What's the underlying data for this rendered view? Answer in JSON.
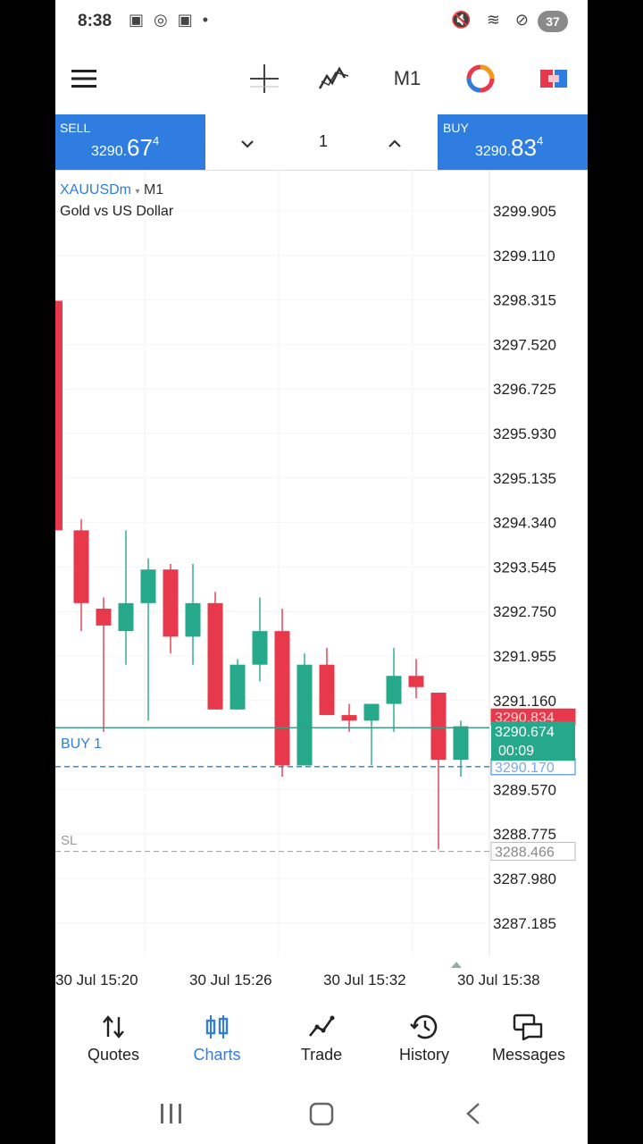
{
  "status_bar": {
    "time": "8:38",
    "notification_icons": "▣ ◎ ▣ •",
    "system_icons": "🔇 ≋ ⊘",
    "battery": "37"
  },
  "toolbar": {
    "menu_icon": "menu-icon",
    "crosshair_icon": "crosshair-icon",
    "indicators_icon": "indicators-icon",
    "timeframe": "M1",
    "objects_icon": "objects-icon",
    "one_click_icon": "one-click-trading-icon"
  },
  "trade_panel": {
    "sell_label": "SELL",
    "sell_price_prefix": "3290.",
    "sell_price_big": "67",
    "sell_price_sup": "4",
    "buy_label": "BUY",
    "buy_price_prefix": "3290.",
    "buy_price_big": "83",
    "buy_price_sup": "4",
    "lot": "1"
  },
  "chart": {
    "symbol": "XAUUSDm",
    "symbol_arrow": "▾",
    "timeframe": "M1",
    "description": "Gold vs US Dollar",
    "position_label": "BUY 1",
    "sl_label": "SL",
    "bid_tag": "3290.674",
    "countdown": "00:09",
    "ask_tag": "3290.834",
    "buy_line_tag": "3290.170",
    "sl_tag": "3288.466",
    "colors": {
      "bull": "#26a88a",
      "bear": "#e8394c",
      "buy_line": "#2f7de1",
      "bid_line": "#e8394c",
      "ask_line": "#26a88a"
    }
  },
  "chart_data": {
    "type": "candlestick",
    "title": "",
    "ylim": [
      3286.8,
      3300.3
    ],
    "y_ticks": [
      "3299.905",
      "3299.110",
      "3298.315",
      "3297.520",
      "3296.725",
      "3295.930",
      "3295.135",
      "3294.340",
      "3293.545",
      "3292.750",
      "3291.955",
      "3291.160",
      "3289.570",
      "3288.775",
      "3287.980",
      "3287.185"
    ],
    "x_ticks": [
      "30 Jul 15:20",
      "30 Jul 15:26",
      "30 Jul 15:32",
      "30 Jul 15:38"
    ],
    "x_tick_candle_index": [
      2,
      8,
      14,
      20
    ],
    "series": [
      {
        "values": [
          {
            "o": 3298.3,
            "h": 3298.3,
            "l": 3294.2,
            "c": 3294.2
          },
          {
            "o": 3294.2,
            "h": 3294.4,
            "l": 3292.4,
            "c": 3292.9
          },
          {
            "o": 3292.8,
            "h": 3293.0,
            "l": 3290.6,
            "c": 3292.5
          },
          {
            "o": 3292.4,
            "h": 3294.2,
            "l": 3291.8,
            "c": 3292.9
          },
          {
            "o": 3292.9,
            "h": 3293.7,
            "l": 3290.8,
            "c": 3293.5
          },
          {
            "o": 3293.5,
            "h": 3293.6,
            "l": 3292.0,
            "c": 3292.3
          },
          {
            "o": 3292.3,
            "h": 3293.6,
            "l": 3291.8,
            "c": 3292.9
          },
          {
            "o": 3292.9,
            "h": 3293.1,
            "l": 3291.0,
            "c": 3291.0
          },
          {
            "o": 3291.0,
            "h": 3291.9,
            "l": 3291.0,
            "c": 3291.8
          },
          {
            "o": 3291.8,
            "h": 3293.0,
            "l": 3291.5,
            "c": 3292.4
          },
          {
            "o": 3292.4,
            "h": 3292.8,
            "l": 3289.8,
            "c": 3290.0
          },
          {
            "o": 3290.0,
            "h": 3292.0,
            "l": 3290.0,
            "c": 3291.8
          },
          {
            "o": 3291.8,
            "h": 3292.1,
            "l": 3290.9,
            "c": 3290.9
          },
          {
            "o": 3290.9,
            "h": 3291.1,
            "l": 3290.6,
            "c": 3290.8
          },
          {
            "o": 3290.8,
            "h": 3291.1,
            "l": 3290.0,
            "c": 3291.1
          },
          {
            "o": 3291.1,
            "h": 3292.1,
            "l": 3290.6,
            "c": 3291.6
          },
          {
            "o": 3291.6,
            "h": 3291.9,
            "l": 3291.2,
            "c": 3291.4
          },
          {
            "o": 3291.3,
            "h": 3291.3,
            "l": 3288.5,
            "c": 3290.1
          },
          {
            "o": 3290.1,
            "h": 3290.8,
            "l": 3289.8,
            "c": 3290.7
          }
        ]
      }
    ],
    "reference_lines": {
      "buy_position": 3290.17,
      "bid": 3290.674,
      "ask": 3290.834,
      "stop_loss": 3288.466
    },
    "grid": true
  },
  "nav": {
    "quotes": "Quotes",
    "charts": "Charts",
    "trade": "Trade",
    "history": "History",
    "messages": "Messages"
  }
}
